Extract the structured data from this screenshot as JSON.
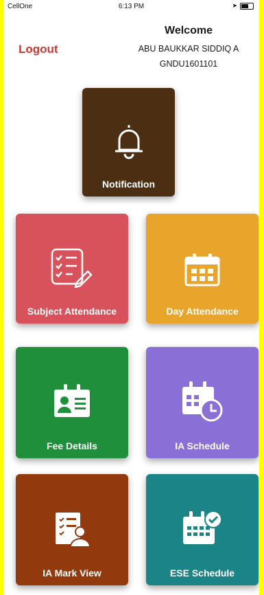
{
  "status_bar": {
    "carrier": "CellOne",
    "time": "6:13 PM"
  },
  "header": {
    "logout_label": "Logout",
    "welcome": "Welcome",
    "student_name": "ABU BAUKKAR SIDDIQ A",
    "student_id": "GNDU1601101"
  },
  "tiles": {
    "notification": {
      "label": "Notification",
      "icon": "bell-icon",
      "color": "#4c2e12"
    },
    "subject_attendance": {
      "label": "Subject Attendance",
      "icon": "checklist-icon",
      "color": "#d7525b"
    },
    "day_attendance": {
      "label": "Day Attendance",
      "icon": "calendar-icon",
      "color": "#e9a42b"
    },
    "fee_details": {
      "label": "Fee Details",
      "icon": "id-card-icon",
      "color": "#1f8f3b"
    },
    "ia_schedule": {
      "label": "IA Schedule",
      "icon": "calendar-clock-icon",
      "color": "#8a6fd6"
    },
    "ia_mark_view": {
      "label": "IA Mark View",
      "icon": "report-user-icon",
      "color": "#923a0e"
    },
    "ese_schedule": {
      "label": "ESE Schedule",
      "icon": "calendar-check-icon",
      "color": "#1b8486"
    }
  }
}
